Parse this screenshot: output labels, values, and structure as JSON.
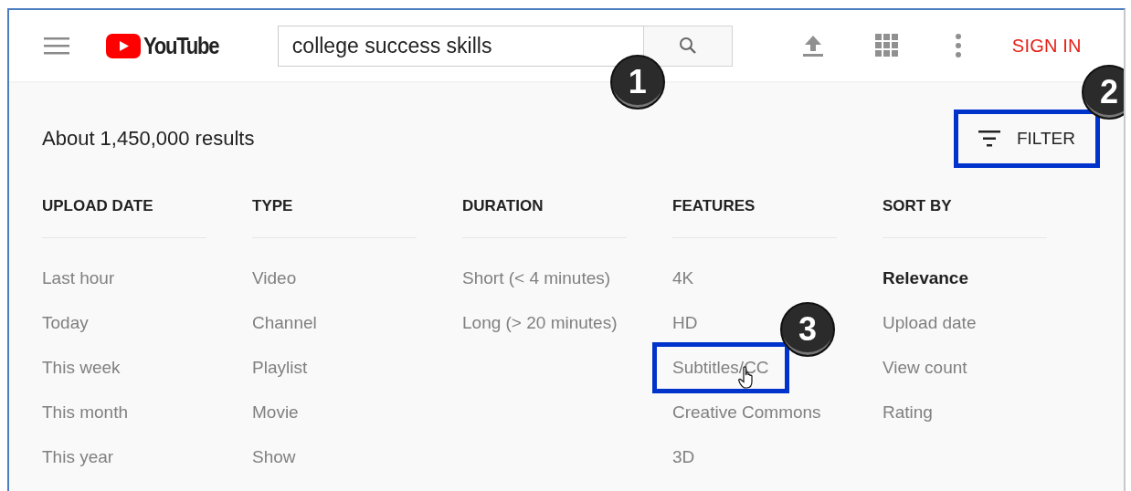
{
  "header": {
    "logo": "YouTube",
    "search": {
      "value": "college success skills",
      "badge": "1"
    },
    "sign_in": "SIGN IN"
  },
  "results_count": "About 1,450,000 results",
  "filter_button": {
    "label": "FILTER",
    "highlighted": true,
    "badge": "2"
  },
  "filter_columns": [
    {
      "heading": "UPLOAD DATE",
      "options": [
        {
          "label": "Last hour",
          "selected": false
        },
        {
          "label": "Today",
          "selected": false
        },
        {
          "label": "This week",
          "selected": false
        },
        {
          "label": "This month",
          "selected": false
        },
        {
          "label": "This year",
          "selected": false
        }
      ]
    },
    {
      "heading": "TYPE",
      "options": [
        {
          "label": "Video",
          "selected": false
        },
        {
          "label": "Channel",
          "selected": false
        },
        {
          "label": "Playlist",
          "selected": false
        },
        {
          "label": "Movie",
          "selected": false
        },
        {
          "label": "Show",
          "selected": false
        }
      ]
    },
    {
      "heading": "DURATION",
      "options": [
        {
          "label": "Short (< 4 minutes)",
          "selected": false
        },
        {
          "label": "Long (> 20 minutes)",
          "selected": false
        }
      ]
    },
    {
      "heading": "FEATURES",
      "options": [
        {
          "label": "4K",
          "selected": false
        },
        {
          "label": "HD",
          "selected": false
        },
        {
          "label": "Subtitles/CC",
          "selected": false,
          "highlighted": true,
          "hovered": true,
          "badge": "3"
        },
        {
          "label": "Creative Commons",
          "selected": false
        },
        {
          "label": "3D",
          "selected": false
        }
      ]
    },
    {
      "heading": "SORT BY",
      "options": [
        {
          "label": "Relevance",
          "selected": true
        },
        {
          "label": "Upload date",
          "selected": false
        },
        {
          "label": "View count",
          "selected": false
        },
        {
          "label": "Rating",
          "selected": false
        }
      ]
    }
  ]
}
